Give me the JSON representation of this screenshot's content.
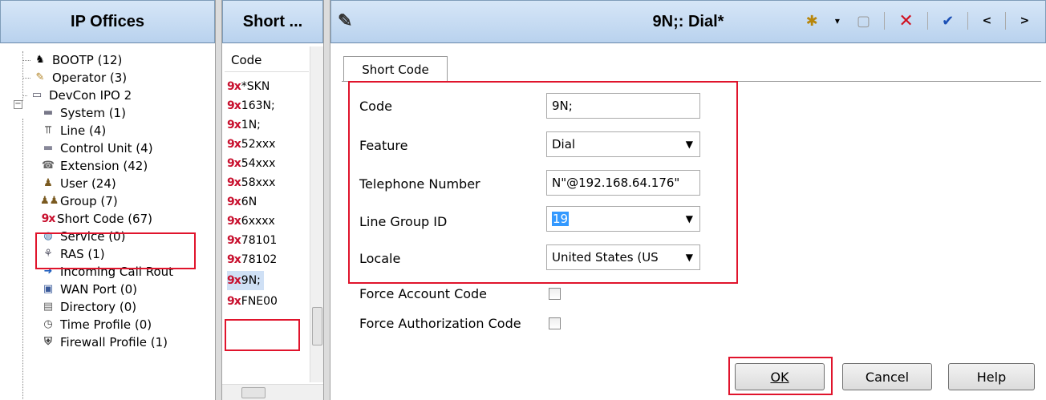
{
  "left_pane": {
    "title": "IP Offices",
    "tree": [
      {
        "label": "BOOTP (12)",
        "icon": "bootp-icon"
      },
      {
        "label": "Operator (3)",
        "icon": "operator-icon"
      },
      {
        "label": "DevCon IPO 2",
        "icon": "ipoffice-icon"
      },
      {
        "label": "System (1)",
        "icon": "system-icon"
      },
      {
        "label": "Line (4)",
        "icon": "line-icon"
      },
      {
        "label": "Control Unit (4)",
        "icon": "control-unit-icon"
      },
      {
        "label": "Extension (42)",
        "icon": "extension-icon"
      },
      {
        "label": "User (24)",
        "icon": "user-icon"
      },
      {
        "label": "Group (7)",
        "icon": "group-icon"
      },
      {
        "label": "Short Code (67)",
        "icon": "short-code-icon"
      },
      {
        "label": "Service (0)",
        "icon": "service-icon"
      },
      {
        "label": "RAS (1)",
        "icon": "ras-icon"
      },
      {
        "label": "Incoming Call Rout",
        "icon": "incoming-call-route-icon"
      },
      {
        "label": "WAN Port (0)",
        "icon": "wan-port-icon"
      },
      {
        "label": "Directory (0)",
        "icon": "directory-icon"
      },
      {
        "label": "Time Profile (0)",
        "icon": "time-profile-icon"
      },
      {
        "label": "Firewall Profile (1)",
        "icon": "firewall-profile-icon"
      }
    ]
  },
  "mid_pane": {
    "title": "Short ...",
    "column_header": "Code",
    "icon_text": "9x",
    "items": [
      "*SKN",
      "163N;",
      "1N;",
      "52xxx",
      "54xxx",
      "58xxx",
      "6N",
      "6xxxx",
      "78101",
      "78102",
      "9N;",
      "FNE00"
    ],
    "selected": "9N;"
  },
  "right_pane": {
    "title": "9N;: Dial*",
    "toolbar": [
      "new-record-icon",
      "dropdown-icon",
      "export-icon",
      "delete-icon",
      "validate-icon",
      "previous-icon",
      "next-icon"
    ],
    "tab": "Short Code",
    "fields": {
      "code_label": "Code",
      "code_value": "9N;",
      "feature_label": "Feature",
      "feature_value": "Dial",
      "telephone_label": "Telephone Number",
      "telephone_value": "N\"@192.168.64.176\"",
      "line_group_label": "Line Group ID",
      "line_group_value": "19",
      "locale_label": "Locale",
      "locale_value": "United States (US",
      "force_account_label": "Force Account Code",
      "force_account_checked": false,
      "force_auth_label": "Force Authorization Code",
      "force_auth_checked": false
    },
    "buttons": {
      "ok": "OK",
      "cancel": "Cancel",
      "help": "Help"
    }
  },
  "colors": {
    "highlight_box": "#e0142c",
    "header_bg": "#c6dcf2",
    "selection": "#3399ff"
  }
}
